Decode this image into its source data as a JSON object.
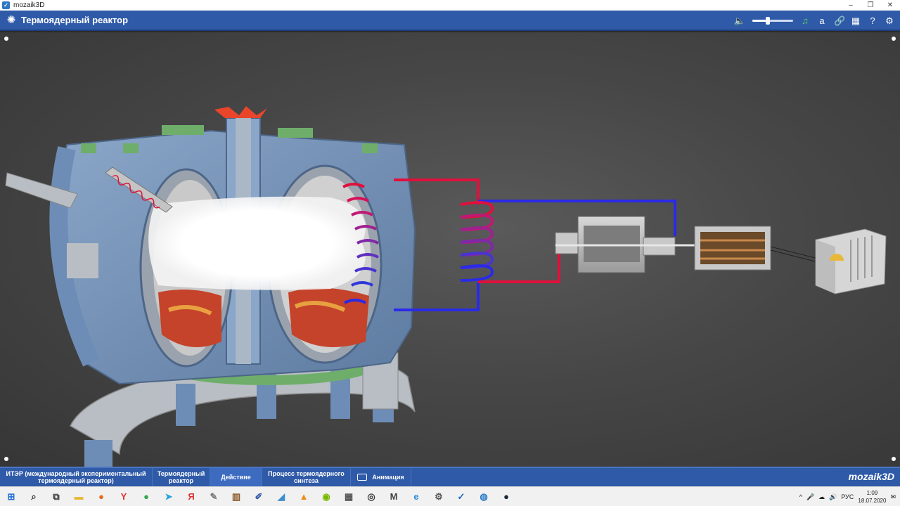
{
  "window": {
    "title": "mozaik3D",
    "controls": [
      "–",
      "❐",
      "✕"
    ]
  },
  "header": {
    "title": "Термоядерный реактор",
    "volume": 0.38,
    "tools": [
      {
        "name": "music-icon",
        "glyph": "♫",
        "green": true
      },
      {
        "name": "font-icon",
        "glyph": "a",
        "green": false
      },
      {
        "name": "link-icon",
        "glyph": "🔗",
        "green": false
      },
      {
        "name": "grid-icon",
        "glyph": "▦",
        "green": false
      },
      {
        "name": "help-icon",
        "glyph": "?",
        "green": false
      },
      {
        "name": "settings-icon",
        "glyph": "⚙",
        "green": false
      }
    ]
  },
  "nav": {
    "items": [
      {
        "label": "ИТЭР (международный экспериментальный термоядерный реактор)",
        "active": false
      },
      {
        "label": "Термоядерный реактор",
        "active": false
      },
      {
        "label": "Действие",
        "active": true
      },
      {
        "label": "Процесс термоядерного синтеза",
        "active": false
      },
      {
        "label": "Анимация",
        "active": false
      }
    ],
    "brand": "mozaik3D"
  },
  "taskbar": {
    "apps": [
      {
        "name": "windows-start-icon",
        "glyph": "⊞",
        "color": "#1e6fd9"
      },
      {
        "name": "search-icon",
        "glyph": "⌕",
        "color": "#333333"
      },
      {
        "name": "task-view-icon",
        "glyph": "⧉",
        "color": "#333333"
      },
      {
        "name": "file-explorer-icon",
        "glyph": "▬",
        "color": "#e8b83a"
      },
      {
        "name": "firefox-icon",
        "glyph": "●",
        "color": "#e66a1f"
      },
      {
        "name": "yandex-browser-icon",
        "glyph": "Y",
        "color": "#e03030"
      },
      {
        "name": "chrome-icon",
        "glyph": "●",
        "color": "#34a853"
      },
      {
        "name": "telegram-icon",
        "glyph": "➤",
        "color": "#2aa3dd"
      },
      {
        "name": "yandex-icon",
        "glyph": "Я",
        "color": "#e03030"
      },
      {
        "name": "notepad-icon",
        "glyph": "✎",
        "color": "#7a7a7a"
      },
      {
        "name": "archive-icon",
        "glyph": "▥",
        "color": "#8a5a2a"
      },
      {
        "name": "editor-icon",
        "glyph": "✐",
        "color": "#3a5fa8"
      },
      {
        "name": "app-icon",
        "glyph": "◢",
        "color": "#3d8fd0"
      },
      {
        "name": "vlc-icon",
        "glyph": "▲",
        "color": "#f08a1a"
      },
      {
        "name": "nvidia-icon",
        "glyph": "◉",
        "color": "#76b900"
      },
      {
        "name": "calculator-icon",
        "glyph": "▦",
        "color": "#555555"
      },
      {
        "name": "camera-icon",
        "glyph": "◎",
        "color": "#3a3a3a"
      },
      {
        "name": "mail-icon",
        "glyph": "M",
        "color": "#444444"
      },
      {
        "name": "edge-icon",
        "glyph": "e",
        "color": "#2a8fd6"
      },
      {
        "name": "gear-icon",
        "glyph": "⚙",
        "color": "#555555"
      },
      {
        "name": "mozaik-icon",
        "glyph": "✓",
        "color": "#1f66b8"
      },
      {
        "name": "vpn-icon",
        "glyph": "◍",
        "color": "#2c7bc9"
      },
      {
        "name": "steam-icon",
        "glyph": "●",
        "color": "#1b2838"
      }
    ],
    "tray": {
      "lang": "РУС",
      "time": "1:09",
      "date": "18.07.2020",
      "icons": [
        "^",
        "🎤",
        "☁",
        "🔊",
        "✉"
      ]
    }
  },
  "colors": {
    "header": "#2f5aa8",
    "hot_pipe": "#e0103c",
    "cold_pipe": "#1e2ee0"
  }
}
